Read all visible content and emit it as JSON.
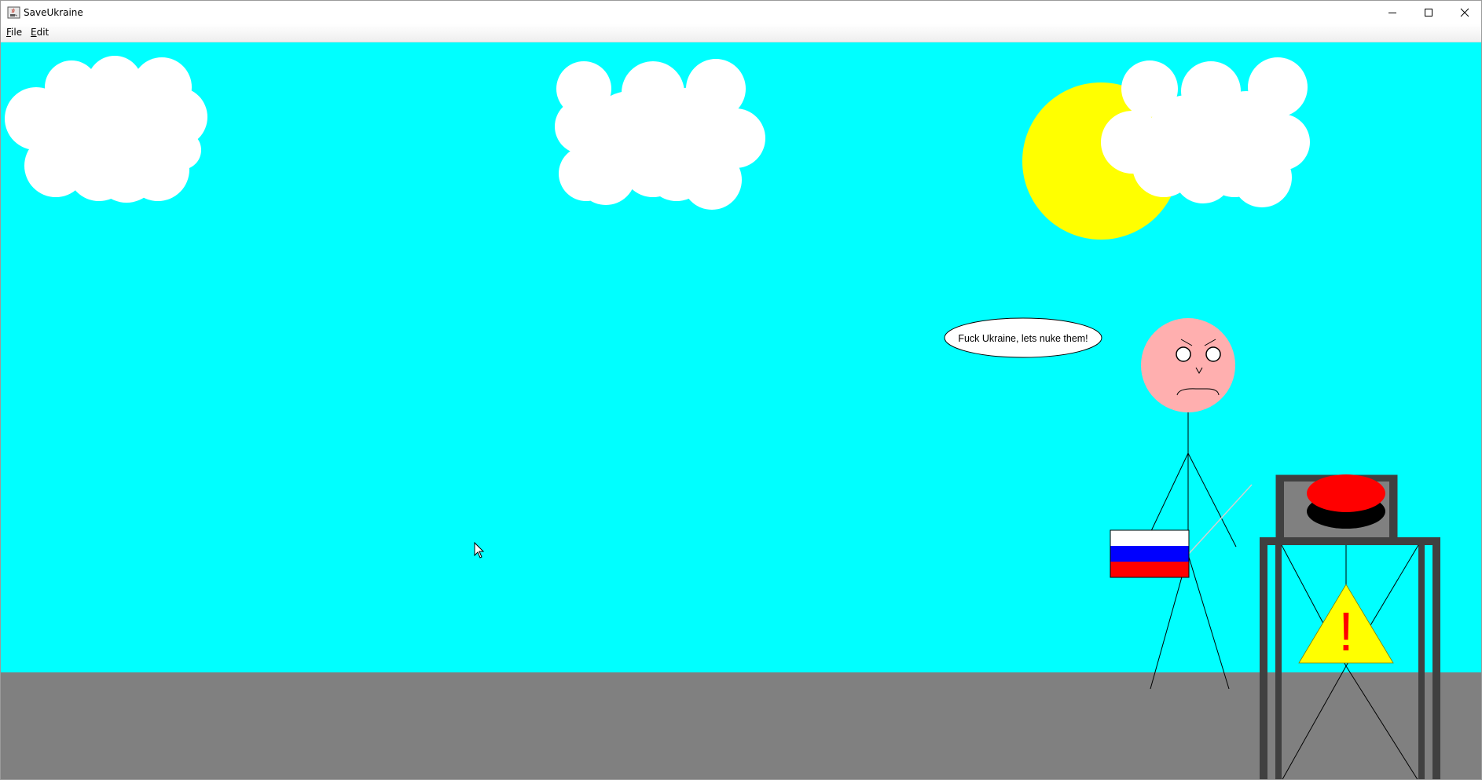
{
  "window": {
    "title": "SaveUkraine",
    "app_icon": "java-cup-icon",
    "controls": {
      "minimize": "minimize-icon",
      "maximize": "maximize-icon",
      "close": "close-icon"
    }
  },
  "menu": {
    "items": [
      {
        "label": "File"
      },
      {
        "label": "Edit"
      }
    ]
  },
  "scene": {
    "speech_bubble": "Fuck Ukraine, lets nuke them!",
    "flag_colors": [
      "#ffffff",
      "#0000ff",
      "#ff0000"
    ],
    "warning_symbol": "!",
    "colors": {
      "sky": "#00ffff",
      "ground": "#808080",
      "sun": "#ffff00",
      "cloud": "#ffffff",
      "face": "#ffafaf",
      "button": "#ff0000",
      "warning": "#ffff00",
      "stand": "#404040"
    }
  }
}
